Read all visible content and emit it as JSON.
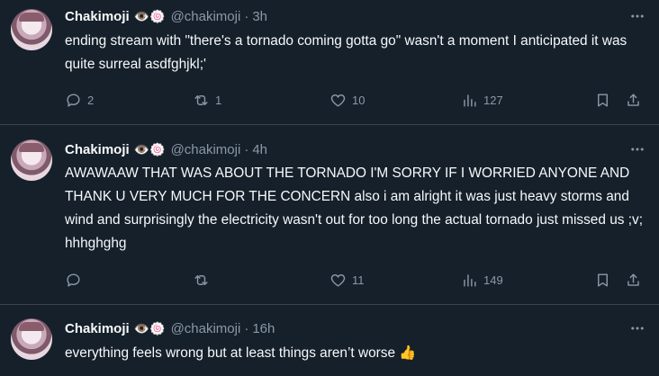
{
  "tweets": [
    {
      "name": "Chakimoji",
      "emoji": "👁️🍥",
      "handle": "@chakimoji",
      "sep": "·",
      "time": "3h",
      "text": "ending stream with \"there's a tornado coming gotta go\" wasn't a moment I anticipated it was quite surreal asdfghjkl;'",
      "replies": "2",
      "reposts": "1",
      "likes": "10",
      "views": "127"
    },
    {
      "name": "Chakimoji",
      "emoji": "👁️🍥",
      "handle": "@chakimoji",
      "sep": "·",
      "time": "4h",
      "text": "AWAWAAW THAT WAS ABOUT THE TORNADO I'M SORRY IF I WORRIED ANYONE AND THANK U VERY MUCH FOR THE CONCERN also i am alright it was just heavy storms and wind and surprisingly the electricity wasn't out for too long the actual tornado just missed us ;v; hhhghghg",
      "replies": "",
      "reposts": "",
      "likes": "11",
      "views": "149"
    },
    {
      "name": "Chakimoji",
      "emoji": "👁️🍥",
      "handle": "@chakimoji",
      "sep": "·",
      "time": "16h",
      "text": "everything feels wrong but at least things aren’t worse",
      "text_emoji": "👍"
    }
  ]
}
